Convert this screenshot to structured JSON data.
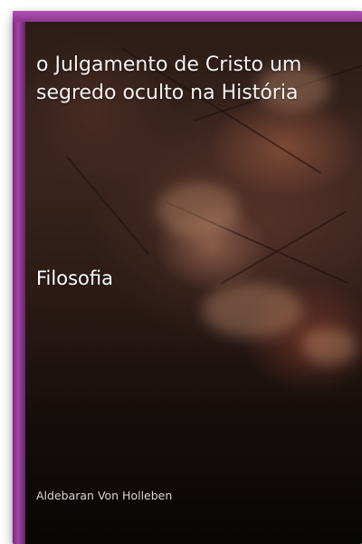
{
  "cover": {
    "title": "o Julgamento de Cristo um segredo oculto na História",
    "category": "Filosofia",
    "author": "Aldebaran Von Holleben",
    "colors": {
      "accent": "#a246a6",
      "text": "#f3f3f3"
    }
  }
}
